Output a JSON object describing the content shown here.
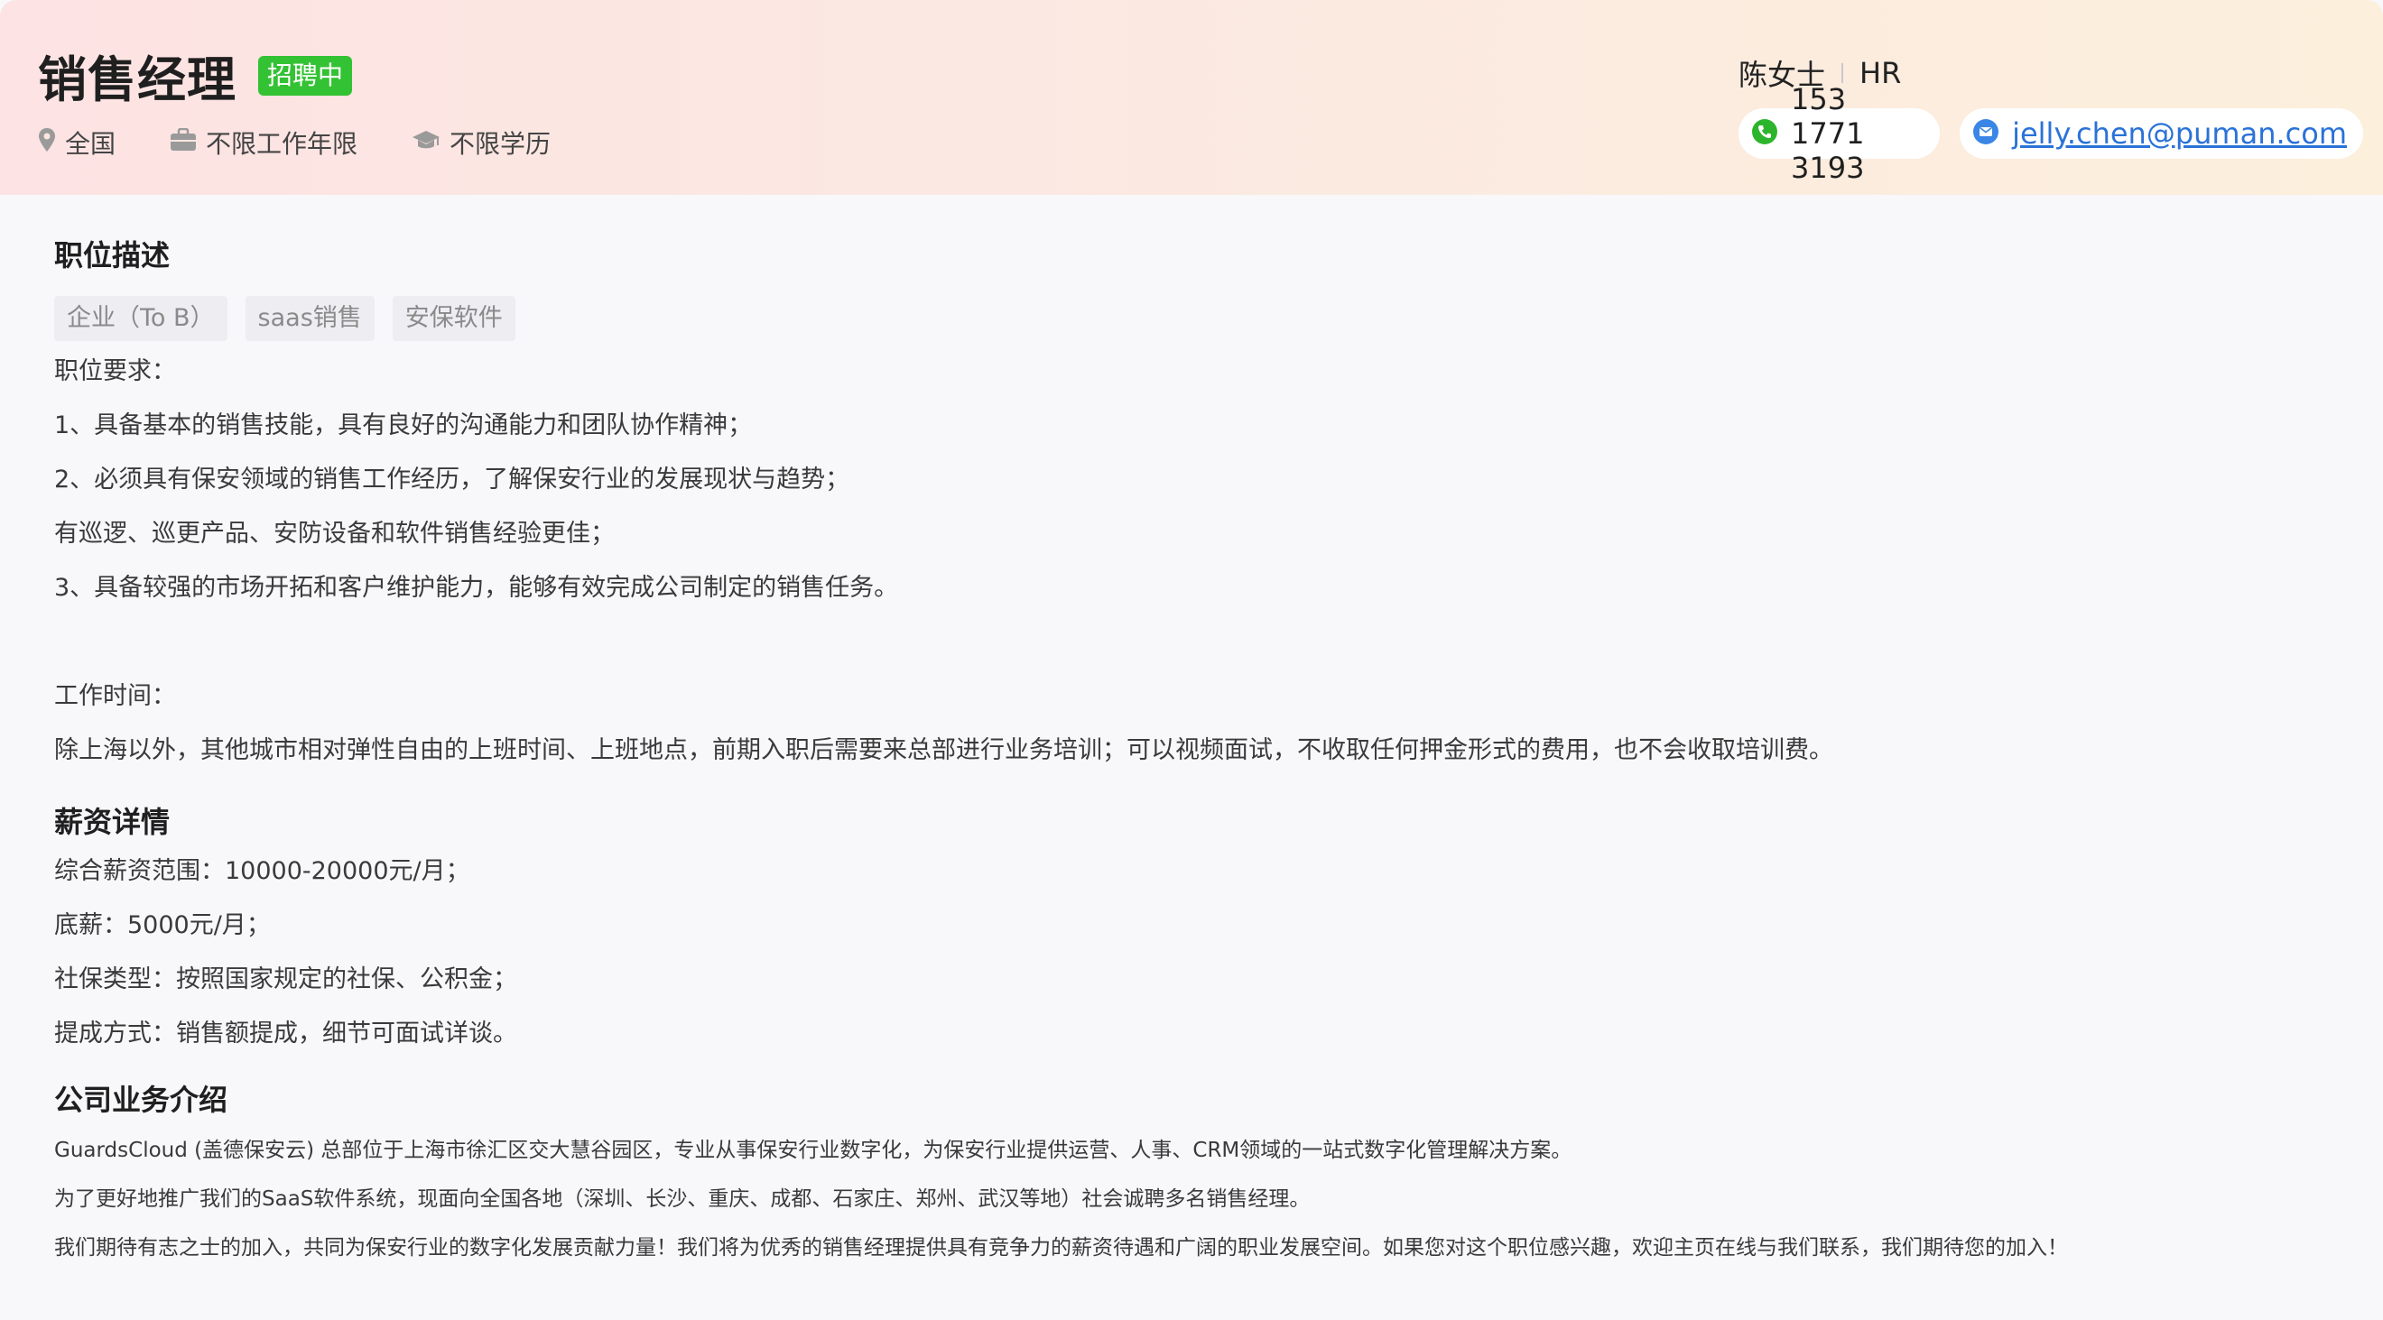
{
  "header": {
    "title": "销售经理",
    "status": "招聘中",
    "meta": {
      "location": "全国",
      "experience": "不限工作年限",
      "education": "不限学历"
    },
    "contact": {
      "name": "陈女士",
      "role": "HR",
      "phone": "153 1771 3193",
      "email": "jelly.chen@puman.com"
    }
  },
  "description": {
    "title": "职位描述",
    "tags": [
      "企业（To B）",
      "saas销售",
      "安保软件"
    ],
    "lines": [
      "职位要求：",
      "1、具备基本的销售技能，具有良好的沟通能力和团队协作精神；",
      "2、必须具有保安领域的销售工作经历，了解保安行业的发展现状与趋势；",
      "有巡逻、巡更产品、安防设备和软件销售经验更佳；",
      "3、具备较强的市场开拓和客户维护能力，能够有效完成公司制定的销售任务。",
      "",
      "工作时间：",
      "除上海以外，其他城市相对弹性自由的上班时间、上班地点，前期入职后需要来总部进行业务培训；可以视频面试，不收取任何押金形式的费用，也不会收取培训费。"
    ]
  },
  "salary": {
    "title": "薪资详情",
    "lines": [
      "综合薪资范围：10000-20000元/月；",
      "底薪：5000元/月；",
      "社保类型：按照国家规定的社保、公积金；",
      "提成方式：销售额提成，细节可面试详谈。"
    ]
  },
  "company": {
    "title": "公司业务介绍",
    "lines": [
      "GuardsCloud (盖德保安云) 总部位于上海市徐汇区交大慧谷园区，专业从事保安行业数字化，为保安行业提供运营、人事、CRM领域的一站式数字化管理解决方案。",
      "为了更好地推广我们的SaaS软件系统，现面向全国各地（深圳、长沙、重庆、成都、石家庄、郑州、武汉等地）社会诚聘多名销售经理。",
      "我们期待有志之士的加入，共同为保安行业的数字化发展贡献力量！我们将为优秀的销售经理提供具有竞争力的薪资待遇和广阔的职业发展空间。如果您对这个职位感兴趣，欢迎主页在线与我们联系，我们期待您的加入！"
    ]
  },
  "colors": {
    "accent_green": "#33c233",
    "link_blue": "#2a72d8",
    "phone_green": "#2cb52c"
  }
}
